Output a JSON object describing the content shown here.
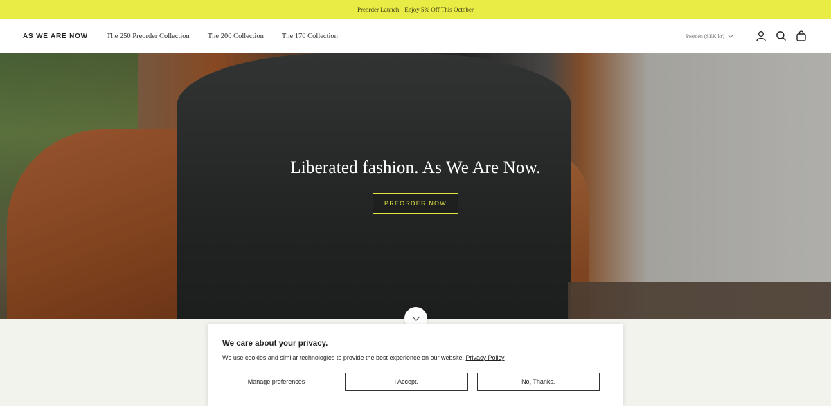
{
  "announcement": {
    "left": "Preorder Launch",
    "right": "Enjoy 5% Off This October"
  },
  "header": {
    "logo": "AS WE ARE NOW",
    "nav": [
      "The 250 Preorder Collection",
      "The 200 Collection",
      "The 170 Collection"
    ],
    "country": "Sweden (SEK kr)",
    "icons": [
      "account-icon",
      "search-icon",
      "bag-icon"
    ]
  },
  "hero": {
    "title": "Liberated fashion. As We Are Now.",
    "button": "PREORDER NOW"
  },
  "cookie": {
    "title": "We care about your privacy.",
    "text": "We use cookies and similar technologies to provide the best experience on our website.",
    "link": "Privacy Policy",
    "manage": "Manage preferences",
    "accept": "I Accept.",
    "decline": "No, Thanks."
  },
  "colors": {
    "announcement_bg": "#eaec46",
    "accent": "#e2e344"
  }
}
